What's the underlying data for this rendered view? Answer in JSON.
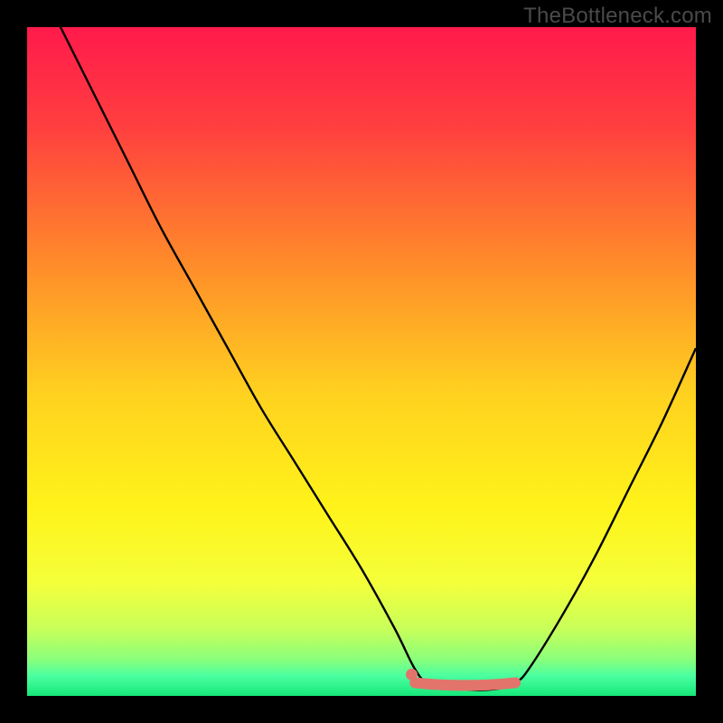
{
  "watermark": "TheBottleneck.com",
  "colors": {
    "frame": "#000000",
    "curve": "#000000",
    "marker": "#e2746b",
    "gradient_stops": [
      {
        "offset": 0.0,
        "color": "#ff1a4b"
      },
      {
        "offset": 0.15,
        "color": "#ff3f3f"
      },
      {
        "offset": 0.35,
        "color": "#ff8a2a"
      },
      {
        "offset": 0.55,
        "color": "#ffd21f"
      },
      {
        "offset": 0.72,
        "color": "#fff31a"
      },
      {
        "offset": 0.83,
        "color": "#f4ff3a"
      },
      {
        "offset": 0.9,
        "color": "#c8ff5a"
      },
      {
        "offset": 0.945,
        "color": "#8bff7a"
      },
      {
        "offset": 0.97,
        "color": "#4bffa0"
      },
      {
        "offset": 1.0,
        "color": "#16e87a"
      }
    ]
  },
  "chart_data": {
    "type": "line",
    "title": "",
    "xlabel": "",
    "ylabel": "",
    "xlim": [
      0,
      100
    ],
    "ylim": [
      0,
      100
    ],
    "series": [
      {
        "name": "bottleneck-curve",
        "x": [
          0,
          5,
          10,
          15,
          20,
          25,
          30,
          35,
          40,
          45,
          50,
          55,
          58,
          60,
          65,
          70,
          73,
          75,
          80,
          85,
          90,
          95,
          100
        ],
        "values": [
          110,
          100,
          90,
          80,
          70,
          61,
          52,
          43,
          35,
          27,
          19,
          10,
          4,
          2,
          1,
          1,
          2,
          4,
          12,
          21,
          31,
          41,
          52
        ]
      }
    ],
    "markers": [
      {
        "name": "marker-dot",
        "x": 57.5,
        "y": 3.2
      }
    ],
    "marker_band": {
      "x_start": 58,
      "x_end": 73,
      "y": 1.7
    }
  }
}
